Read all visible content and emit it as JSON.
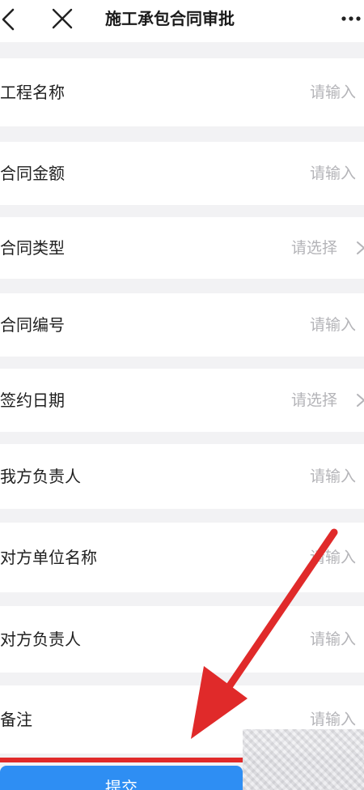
{
  "header": {
    "title": "施工承包合同审批",
    "back_icon": "chevron-left-icon",
    "close_icon": "close-icon",
    "more_icon": "more-horizontal-icon"
  },
  "form": {
    "rows": [
      {
        "label": "工程名称",
        "placeholder": "请输入",
        "kind": "input"
      },
      {
        "label": "合同金额",
        "placeholder": "请输入",
        "kind": "input"
      },
      {
        "label": "合同类型",
        "placeholder": "请选择",
        "kind": "select"
      },
      {
        "label": "合同编号",
        "placeholder": "请输入",
        "kind": "input"
      },
      {
        "label": "签约日期",
        "placeholder": "请选择",
        "kind": "select"
      },
      {
        "label": "我方负责人",
        "placeholder": "请输入",
        "kind": "input"
      },
      {
        "label": "对方单位名称",
        "placeholder": "请输入",
        "kind": "input"
      },
      {
        "label": "对方负责人",
        "placeholder": "请输入",
        "kind": "input"
      },
      {
        "label": "备注",
        "placeholder": "请输入",
        "kind": "input"
      }
    ]
  },
  "submit": {
    "label": "提交"
  },
  "colors": {
    "accent": "#2e8ef3",
    "annotation": "#e02a2a",
    "background": "#f2f2f4",
    "placeholder": "#b4b4b8"
  }
}
